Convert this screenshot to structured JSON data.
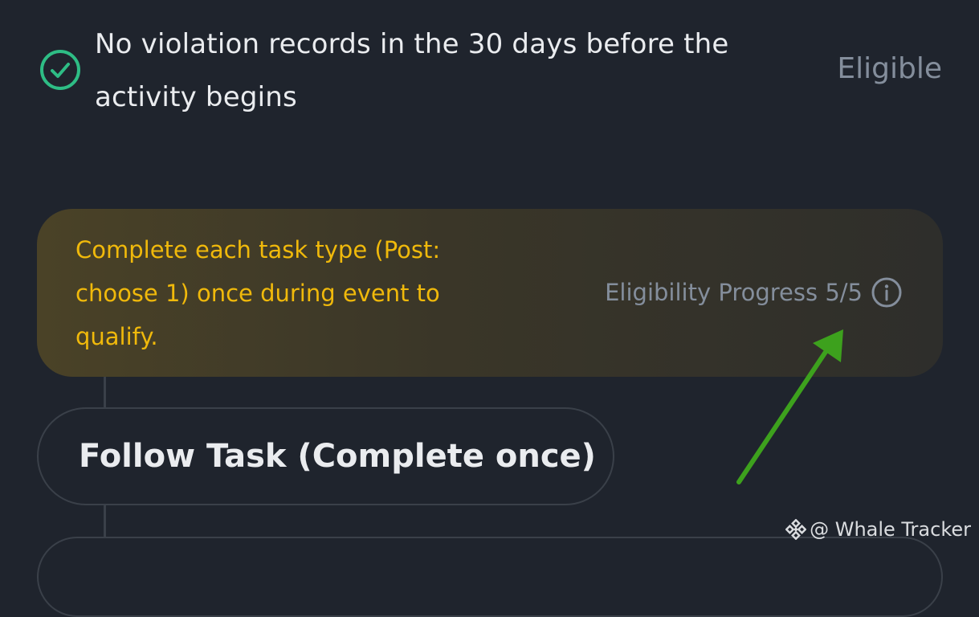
{
  "requirement": {
    "text": "No violation records in the 30 days before the activity begins",
    "status": "Eligible",
    "icon": "check-circle-icon",
    "icon_color": "#2ebd85"
  },
  "task_banner": {
    "text": "Complete each task type (Post: choose 1) once during event to qualify.",
    "progress_label": "Eligibility Progress 5/5",
    "info_icon": "info-icon",
    "text_color": "#f0b90b"
  },
  "follow_task": {
    "title": "Follow Task (Complete once)"
  },
  "annotation": {
    "arrow_color": "#3da11d"
  },
  "watermark": {
    "text": "@ Whale Tracker",
    "icon": "binance-logo-icon"
  }
}
